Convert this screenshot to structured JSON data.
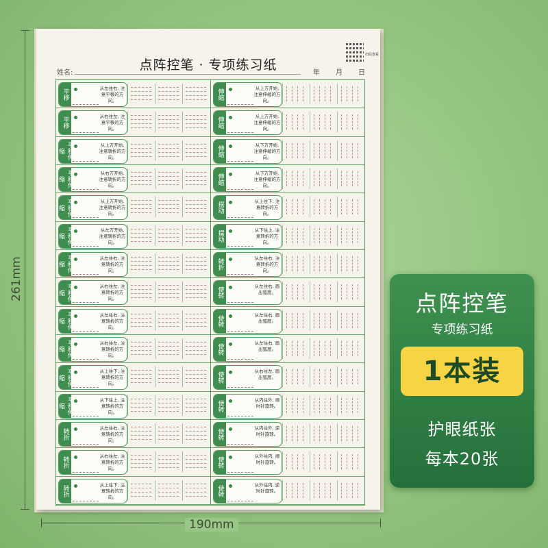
{
  "dimensions": {
    "height": "261mm",
    "width": "190mm"
  },
  "sheet": {
    "title": "点阵控笔 · 专项练习纸",
    "qr_caption": "扫码查看",
    "name_label": "姓名:",
    "date": {
      "year": "年",
      "month": "月",
      "day": "日"
    },
    "left_rows": [
      {
        "tab": "平移",
        "instruction": "从左往右, 注意平移的方向。"
      },
      {
        "tab": "平移",
        "instruction": "从右往左, 注意平移的方向。"
      },
      {
        "tab": "平移伸缩",
        "instruction": "从上方开始, 注意转折的方向。"
      },
      {
        "tab": "平移伸缩",
        "instruction": "从右方开始, 注意转折的方向。"
      },
      {
        "tab": "平移伸缩",
        "instruction": "从上方开始, 注意转折的方向。"
      },
      {
        "tab": "平移伸缩",
        "instruction": "从左方开始, 注意转折的方向。"
      },
      {
        "tab": "平移伸缩",
        "instruction": "从左往右, 注意转折的方向。"
      },
      {
        "tab": "平移伸缩",
        "instruction": "从右往左, 注意转折的方向。"
      },
      {
        "tab": "平移伸缩",
        "instruction": "从左往右, 注意转折的方向。"
      },
      {
        "tab": "平移伸缩",
        "instruction": "从右往左, 注意转折的方向。"
      },
      {
        "tab": "平移伸缩",
        "instruction": "从上往下, 注意转折的方向。"
      },
      {
        "tab": "平移伸缩",
        "instruction": "从下往上, 注意转折的方向。"
      },
      {
        "tab": "转折",
        "instruction": "从左往右, 注意转折的方向。"
      },
      {
        "tab": "转折",
        "instruction": "从右往左, 注意转折的方向。"
      },
      {
        "tab": "转折",
        "instruction": "从上往下, 注意转折的方向。"
      }
    ],
    "right_rows": [
      {
        "tab": "伸缩",
        "instruction": "从上方开始, 注意伸缩的方向。"
      },
      {
        "tab": "伸缩",
        "instruction": "从上方开始, 注意伸缩的方向。"
      },
      {
        "tab": "伸缩",
        "instruction": "从下方开始, 注意伸缩的方向。"
      },
      {
        "tab": "伸缩",
        "instruction": "从下方开始, 注意伸缩的方向。"
      },
      {
        "tab": "摆动",
        "instruction": "从上往下, 注意转折的方向。"
      },
      {
        "tab": "摆动",
        "instruction": "从下往上, 注意转折的方向。"
      },
      {
        "tab": "转折",
        "instruction": "从左往右, 注意转折的方向。"
      },
      {
        "tab": "使转",
        "instruction": "从左往右, 画出弧度。"
      },
      {
        "tab": "使转",
        "instruction": "从左往右, 画出弧度。"
      },
      {
        "tab": "使转",
        "instruction": "从左往右, 画出弧度。"
      },
      {
        "tab": "使转",
        "instruction": "从右往左, 画出弧度。"
      },
      {
        "tab": "使转",
        "instruction": "从内往外, 顺时针旋转。"
      },
      {
        "tab": "使转",
        "instruction": "从内往外, 逆时针旋转。"
      },
      {
        "tab": "使转",
        "instruction": "从外往内, 顺时针旋转。"
      },
      {
        "tab": "使转",
        "instruction": "从外往内, 逆时针旋转。"
      }
    ]
  },
  "badge": {
    "title": "点阵控笔",
    "subtitle": "专项练习纸",
    "highlight": "1本装",
    "feature1": "护眼纸张",
    "feature2": "每本20张",
    "colors": {
      "panel": "#2f7f43",
      "highlight_bg": "#f6d443",
      "highlight_text": "#1d4a27"
    }
  }
}
